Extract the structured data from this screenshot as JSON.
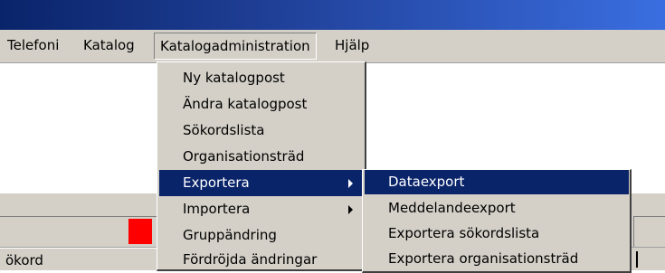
{
  "menubar": {
    "items": [
      "Telefoni",
      "Katalog",
      "Katalogadministration",
      "Hjälp"
    ]
  },
  "dropdown": {
    "items": [
      {
        "label": "Ny katalogpost",
        "submenu": false
      },
      {
        "label": "Ändra katalogpost",
        "submenu": false
      },
      {
        "label": "Sökordslista",
        "submenu": false
      },
      {
        "label": "Organisationsträd",
        "submenu": false
      },
      {
        "label": "Exportera",
        "submenu": true,
        "highlighted": true
      },
      {
        "label": "Importera",
        "submenu": true
      },
      {
        "label": "Gruppändring",
        "submenu": false
      },
      {
        "label": "Fördröjda ändringar",
        "submenu": false
      }
    ]
  },
  "submenu": {
    "items": [
      {
        "label": "Dataexport",
        "highlighted": true
      },
      {
        "label": "Meddelandeexport"
      },
      {
        "label": "Exportera sökordslista"
      },
      {
        "label": "Exportera organisationsträd"
      }
    ]
  },
  "form": {
    "field_label": "ökord"
  },
  "colors": {
    "highlight": "#0a246a",
    "marker": "#ff0000",
    "chrome": "#d4d0c8"
  }
}
